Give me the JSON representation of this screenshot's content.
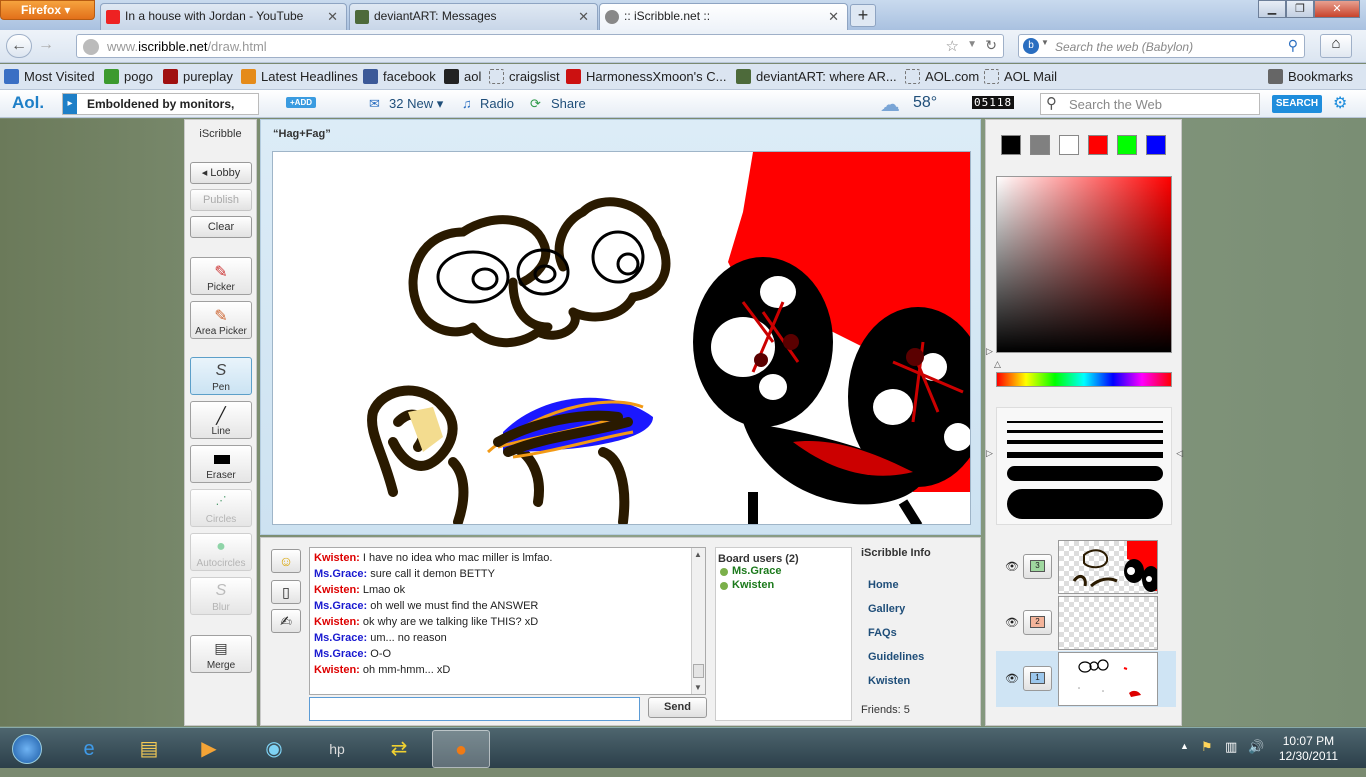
{
  "browser": {
    "menu_button": "Firefox",
    "tabs": [
      {
        "title": "In a house with Jordan - YouTube"
      },
      {
        "title": "deviantART: Messages"
      },
      {
        "title": ":: iScribble.net ::"
      }
    ],
    "new_tab": "+",
    "url_prefix": "www.",
    "url_domain": "iscribble.net",
    "url_path": "/draw.html",
    "search_placeholder": "Search the web (Babylon)"
  },
  "bookmarks": [
    {
      "label": "Most Visited",
      "color": "#3a6fc4"
    },
    {
      "label": "pogo",
      "color": "#3c9a2e"
    },
    {
      "label": "pureplay",
      "color": "#a01010"
    },
    {
      "label": "Latest Headlines",
      "color": "#e58b1a"
    },
    {
      "label": "facebook",
      "color": "#3b5998"
    },
    {
      "label": "aol",
      "color": "#222"
    },
    {
      "label": "craigslist",
      "color": "#ffffff"
    },
    {
      "label": "HarmonessXmoon's C...",
      "color": "#cc1111"
    },
    {
      "label": "deviantART: where AR...",
      "color": "#4d6a3a"
    },
    {
      "label": "AOL.com",
      "color": "#ffffff"
    },
    {
      "label": "AOL Mail",
      "color": "#ffffff"
    }
  ],
  "bookmarks_menu": "Bookmarks",
  "aolbar": {
    "logo": "Aol.",
    "ticker": "Emboldened by monitors,",
    "add": "+ADD",
    "new_count": "32 New",
    "radio": "Radio",
    "share": "Share",
    "temp": "58°",
    "counter": "05118",
    "search_placeholder": "Search the Web",
    "search_button": "SEARCH"
  },
  "tools": {
    "title": "iScribble",
    "lobby": "◂ Lobby",
    "publish": "Publish",
    "clear": "Clear",
    "picker": "Picker",
    "area_picker": "Area Picker",
    "pen": "Pen",
    "line": "Line",
    "eraser": "Eraser",
    "circles": "Circles",
    "autocircles": "Autocircles",
    "blur": "Blur",
    "merge": "Merge"
  },
  "canvas": {
    "title": "“Hag+Fag”"
  },
  "chat": {
    "messages": [
      {
        "user": "Kwisten:",
        "text": " I have no idea who mac miller is lmfao.",
        "cls": "kw"
      },
      {
        "user": "Ms.Grace:",
        "text": " sure call it demon BETTY",
        "cls": "mg"
      },
      {
        "user": "Kwisten:",
        "text": " Lmao ok",
        "cls": "kw"
      },
      {
        "user": "Ms.Grace:",
        "text": " oh well we must find the ANSWER",
        "cls": "mg"
      },
      {
        "user": "Kwisten:",
        "text": " ok why are we talking like THIS? xD",
        "cls": "kw"
      },
      {
        "user": "Ms.Grace:",
        "text": " um... no reason",
        "cls": "mg"
      },
      {
        "user": "Ms.Grace:",
        "text": " O-O",
        "cls": "mg"
      },
      {
        "user": "Kwisten:",
        "text": " oh mm-hmm... xD",
        "cls": "kw"
      }
    ],
    "send": "Send"
  },
  "board_users": {
    "title": "Board users (2)",
    "users": [
      "Ms.Grace",
      "Kwisten"
    ]
  },
  "info": {
    "title": "iScribble Info",
    "links": [
      "Home",
      "Gallery",
      "FAQs",
      "Guidelines",
      "Kwisten"
    ],
    "friends": "Friends: 5"
  },
  "palette": [
    "#000000",
    "#808080",
    "#ffffff",
    "#ff0000",
    "#00ff00",
    "#0000ff"
  ],
  "layers": [
    {
      "num": "3"
    },
    {
      "num": "2"
    },
    {
      "num": "1"
    }
  ],
  "taskbar": {
    "time": "10:07 PM",
    "date": "12/30/2011"
  }
}
